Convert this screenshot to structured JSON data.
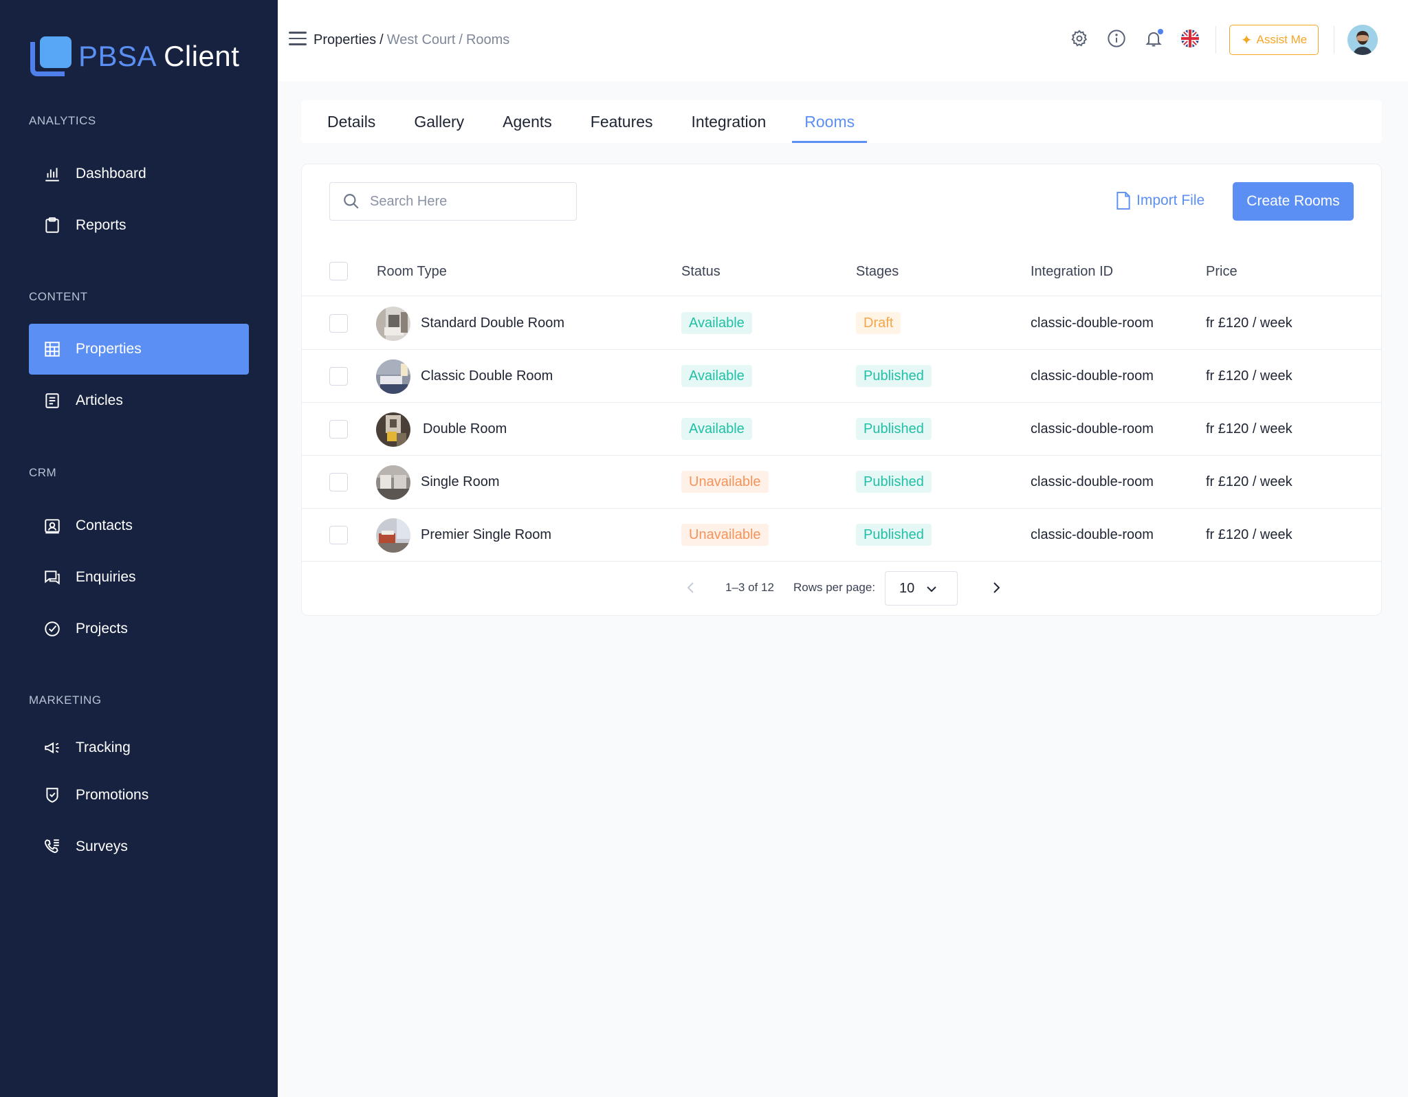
{
  "brand": {
    "part1": "PBSA",
    "part2": "Client"
  },
  "sidebar": {
    "sections": [
      {
        "label": "ANALYTICS",
        "items": [
          {
            "label": "Dashboard",
            "icon": "bar-chart-icon"
          },
          {
            "label": "Reports",
            "icon": "clipboard-icon"
          }
        ]
      },
      {
        "label": "CONTENT",
        "items": [
          {
            "label": "Properties",
            "icon": "building-icon",
            "active": true
          },
          {
            "label": "Articles",
            "icon": "document-icon"
          }
        ]
      },
      {
        "label": "CRM",
        "items": [
          {
            "label": "Contacts",
            "icon": "contact-card-icon"
          },
          {
            "label": "Enquiries",
            "icon": "chat-icon"
          },
          {
            "label": "Projects",
            "icon": "check-circle-icon"
          }
        ]
      },
      {
        "label": "MARKETING",
        "items": [
          {
            "label": "Tracking",
            "icon": "megaphone-icon"
          },
          {
            "label": "Promotions",
            "icon": "shield-check-icon"
          },
          {
            "label": "Surveys",
            "icon": "phone-list-icon"
          }
        ]
      }
    ]
  },
  "header": {
    "breadcrumb": {
      "first": "Properties",
      "sep": "/",
      "second": "West Court",
      "third": "Rooms"
    },
    "assist_label": "Assist Me"
  },
  "tabs": [
    "Details",
    "Gallery",
    "Agents",
    "Features",
    "Integration",
    "Rooms"
  ],
  "active_tab": "Rooms",
  "toolbar": {
    "search_placeholder": "Search Here",
    "import_label": "Import File",
    "create_label": "Create Rooms"
  },
  "table": {
    "columns": [
      "Room Type",
      "Status",
      "Stages",
      "Integration ID",
      "Price"
    ],
    "rows": [
      {
        "name": "Standard Double Room",
        "status": "Available",
        "stage": "Draft",
        "integration_id": "classic-double-room",
        "price": "fr £120 / week"
      },
      {
        "name": "Classic Double Room",
        "status": "Available",
        "stage": "Published",
        "integration_id": "classic-double-room",
        "price": "fr £120 / week"
      },
      {
        "name": "Double Room",
        "status": "Available",
        "stage": "Published",
        "integration_id": "classic-double-room",
        "price": "fr £120 / week"
      },
      {
        "name": "Single Room",
        "status": "Unavailable",
        "stage": "Published",
        "integration_id": "classic-double-room",
        "price": "fr £120 / week"
      },
      {
        "name": "Premier Single Room",
        "status": "Unavailable",
        "stage": "Published",
        "integration_id": "classic-double-room",
        "price": "fr £120 / week"
      }
    ]
  },
  "pagination": {
    "range": "1–3 of 12",
    "rows_per_page_label": "Rows per page:",
    "rows_per_page": "10"
  },
  "colors": {
    "sidebar_bg": "#16223f",
    "accent": "#5b8ff3",
    "available": "#1fc0a5",
    "unavailable": "#f5935a",
    "draft": "#f5a64b",
    "assist": "#f5a623"
  }
}
